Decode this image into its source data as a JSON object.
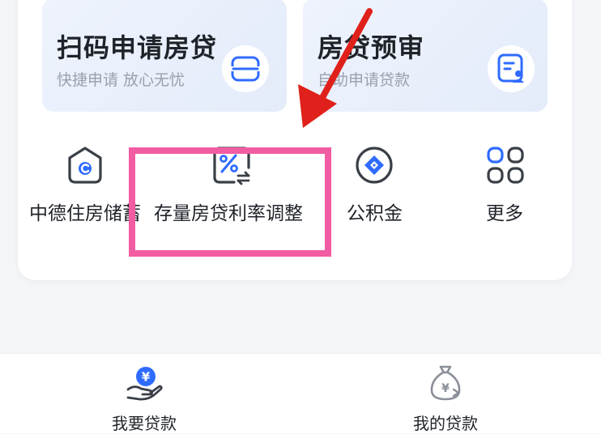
{
  "feature_cards": [
    {
      "title": "扫码申请房贷",
      "subtitle": "快捷申请 放心无忧",
      "icon": "scan-icon"
    },
    {
      "title": "房贷预审",
      "subtitle": "自助申请贷款",
      "icon": "document-user-icon"
    }
  ],
  "shortcuts": [
    {
      "label": "中德住房储蓄",
      "icon": "housing-savings-icon"
    },
    {
      "label": "存量房贷利率调整",
      "icon": "rate-adjust-icon"
    },
    {
      "label": "公积金",
      "icon": "provident-fund-icon"
    },
    {
      "label": "更多",
      "icon": "more-grid-icon"
    }
  ],
  "tabbar": [
    {
      "label": "我要贷款",
      "icon": "loan-hand-icon"
    },
    {
      "label": "我的贷款",
      "icon": "money-bag-icon"
    }
  ],
  "colors": {
    "accent": "#2f6bff",
    "highlight": "#f25ca2",
    "arrow": "#e0201a",
    "text": "#1f2329",
    "subtext": "#9aa1ad"
  }
}
